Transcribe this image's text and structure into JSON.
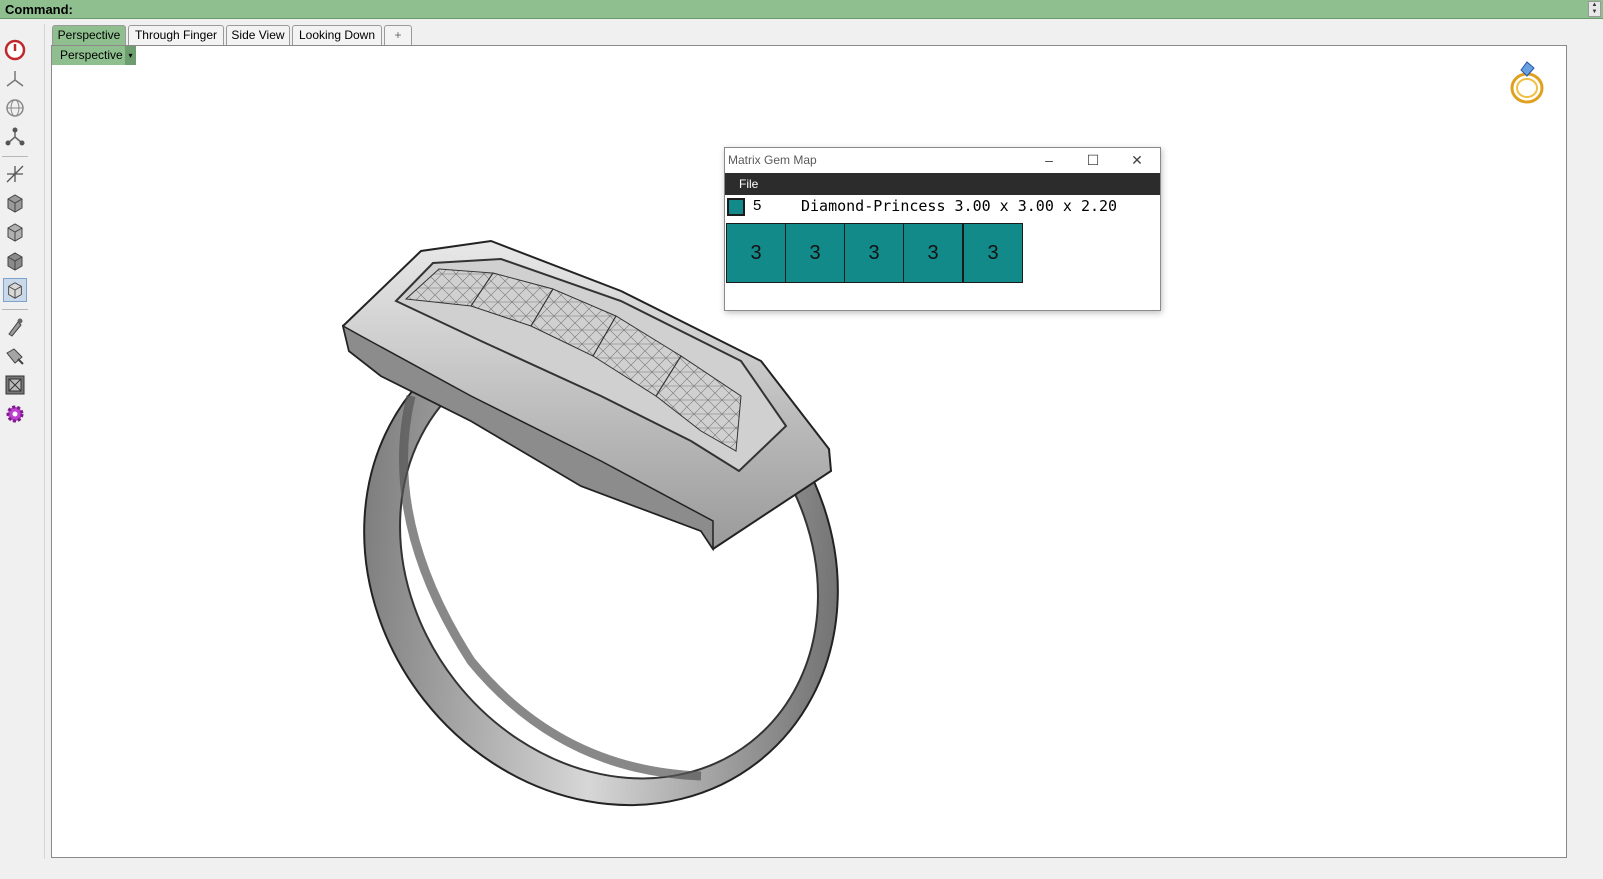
{
  "command_bar": {
    "label": "Command:"
  },
  "toolbar": {
    "icons": [
      "power-icon",
      "tripod-icon",
      "globe-icon",
      "molecule-icon",
      "axis-icon",
      "cube-icon",
      "cube-icon",
      "cube-icon",
      "cube-icon",
      "brush-icon",
      "paint-icon",
      "render-icon",
      "gear-icon"
    ]
  },
  "tabs": [
    {
      "label": "Perspective",
      "active": true
    },
    {
      "label": "Through Finger"
    },
    {
      "label": "Side View"
    },
    {
      "label": "Looking Down"
    },
    {
      "label": "+"
    }
  ],
  "viewport": {
    "label": "Perspective",
    "dropdown_glyph": "▾"
  },
  "gem_map": {
    "title": "Matrix Gem Map",
    "menu": [
      "File"
    ],
    "controls": {
      "minimize": "–",
      "maximize": "☐",
      "close": "✕"
    },
    "legend": {
      "count": "5",
      "description": "Diamond-Princess 3.00 x 3.00 x 2.20",
      "color": "#138a8a"
    },
    "cells": [
      "3",
      "3",
      "3",
      "3",
      "3"
    ]
  },
  "colors": {
    "accent_green": "#8fbf8f",
    "gem_teal": "#138a8a"
  }
}
